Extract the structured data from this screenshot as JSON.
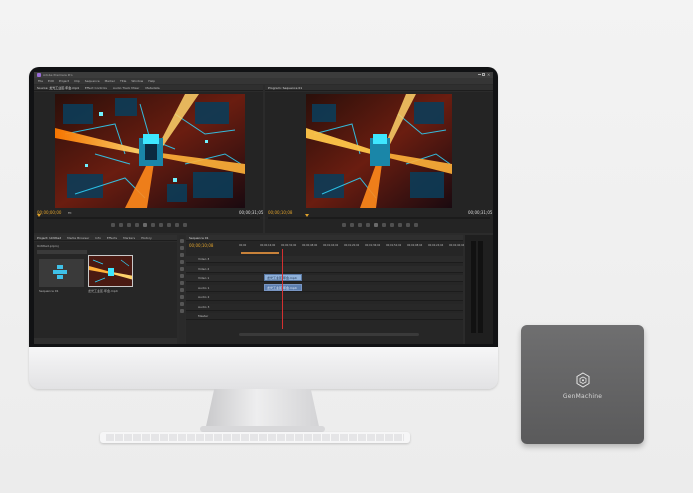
{
  "app": {
    "title": "Adobe Premiere Pro",
    "menus": [
      "File",
      "Edit",
      "Project",
      "Clip",
      "Sequence",
      "Marker",
      "Title",
      "Window",
      "Help"
    ]
  },
  "source_monitor": {
    "tabs": [
      "Source: 龙光工业区·年会.mp4",
      "Effect Controls",
      "Audio Track Mixer",
      "Metadata"
    ],
    "timecode_in": "00;00;00;00",
    "timecode_out": "00;00;31;05",
    "fit": "Fit"
  },
  "program_monitor": {
    "tabs": [
      "Program: Sequence 01"
    ],
    "timecode_in": "00;00;10;08",
    "timecode_out": "00;00;31;05"
  },
  "project_panel": {
    "tabs": [
      "Project: Untitled",
      "Media Browser",
      "Info",
      "Effects",
      "Markers",
      "History"
    ],
    "project_file": "Untitled.prproj",
    "items": [
      {
        "name": "Sequence 01",
        "duration": "31;05"
      },
      {
        "name": "龙光工业区·年会.mp4",
        "duration": "31;05"
      }
    ]
  },
  "timeline": {
    "tab": "Sequence 01",
    "timecode": "00;00;10;08",
    "ruler": [
      "00;00",
      "00;00;16;00",
      "00;00;32;00",
      "00;00;48;00",
      "00;01;04;02",
      "00;01;20;02",
      "00;01;36;02",
      "00;01;52;02",
      "00;02;08;04",
      "00;02;24;04",
      "00;02;40;04"
    ],
    "tracks": [
      {
        "id": "V3",
        "name": "Video 3"
      },
      {
        "id": "V2",
        "name": "Video 2"
      },
      {
        "id": "V1",
        "name": "Video 1"
      },
      {
        "id": "A1",
        "name": "Audio 1"
      },
      {
        "id": "A2",
        "name": "Audio 2"
      },
      {
        "id": "A3",
        "name": "Audio 3"
      },
      {
        "id": "M",
        "name": "Master"
      }
    ],
    "clip_label": "龙光工业区·年会.mp4"
  },
  "device": {
    "brand": "GenMachine"
  },
  "colors": {
    "accent": "#e0a22b",
    "playhead": "#d33030",
    "clip_video": "#8fb1da",
    "clip_audio": "#5d7fb0",
    "device_body": "#646465"
  }
}
